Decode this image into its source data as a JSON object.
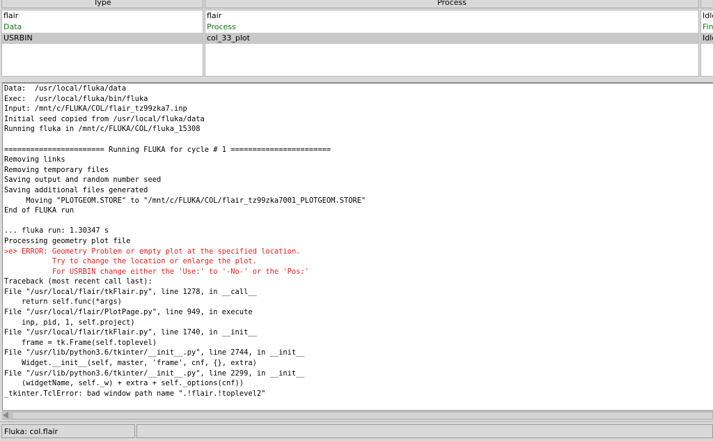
{
  "table": {
    "columns": {
      "type": "Type",
      "process": "Process"
    },
    "rows": [
      {
        "type": "flair",
        "process": "flair",
        "status": "Idle",
        "green": false,
        "selected": false
      },
      {
        "type": "Data",
        "process": "Process",
        "status": "Fin",
        "green": true,
        "selected": false
      },
      {
        "type": "USRBIN",
        "process": "col_33_plot",
        "status": "Idle",
        "green": false,
        "selected": true
      }
    ]
  },
  "log": {
    "lines": [
      {
        "text": "Data:  /usr/local/fluka/data",
        "error": false
      },
      {
        "text": "Exec:  /usr/local/fluka/bin/fluka",
        "error": false
      },
      {
        "text": "Input: /mnt/c/FLUKA/COL/flair_tz99zka7.inp",
        "error": false
      },
      {
        "text": "Initial seed copied from /usr/local/fluka/data",
        "error": false
      },
      {
        "text": "Running fluka in /mnt/c/FLUKA/COL/fluka_15308",
        "error": false
      },
      {
        "text": "",
        "error": false
      },
      {
        "text": "======================= Running FLUKA for cycle # 1 =======================",
        "error": false
      },
      {
        "text": "Removing links",
        "error": false
      },
      {
        "text": "Removing temporary files",
        "error": false
      },
      {
        "text": "Saving output and random number seed",
        "error": false
      },
      {
        "text": "Saving additional files generated",
        "error": false
      },
      {
        "text": "     Moving \"PLOTGEOM.STORE\" to \"/mnt/c/FLUKA/COL/flair_tz99zka7001_PLOTGEOM.STORE\"",
        "error": false
      },
      {
        "text": "End of FLUKA run",
        "error": false
      },
      {
        "text": "",
        "error": false
      },
      {
        "text": "... fluka run: 1.30347 s",
        "error": false
      },
      {
        "text": "Processing geometry plot file",
        "error": false
      },
      {
        "text": ">e> ERROR: Geometry Problem or empty plot at the specified location.",
        "error": true
      },
      {
        "text": "           Try to change the location or enlarge the plot.",
        "error": true
      },
      {
        "text": "           For USRBIN change either the 'Use:' to '-No-' or the 'Pos:'",
        "error": true
      },
      {
        "text": "Traceback (most recent call last):",
        "error": false
      },
      {
        "text": "File \"/usr/local/flair/tkFlair.py\", line 1278, in __call__",
        "error": false
      },
      {
        "text": "    return self.func(*args)",
        "error": false
      },
      {
        "text": "File \"/usr/local/flair/PlotPage.py\", line 949, in execute",
        "error": false
      },
      {
        "text": "    inp, pid, 1, self.project)",
        "error": false
      },
      {
        "text": "File \"/usr/local/flair/tkFlair.py\", line 1740, in __init__",
        "error": false
      },
      {
        "text": "    frame = tk.Frame(self.toplevel)",
        "error": false
      },
      {
        "text": "File \"/usr/lib/python3.6/tkinter/__init__.py\", line 2744, in __init__",
        "error": false
      },
      {
        "text": "    Widget.__init__(self, master, 'frame', cnf, {}, extra)",
        "error": false
      },
      {
        "text": "File \"/usr/lib/python3.6/tkinter/__init__.py\", line 2299, in __init__",
        "error": false
      },
      {
        "text": "    (widgetName, self._w) + extra + self._options(cnf))",
        "error": false
      },
      {
        "text": "_tkinter.TclError: bad window path name \".!flair.!toplevel2\"",
        "error": false
      }
    ]
  },
  "status": {
    "text": "Fluka: col.flair"
  },
  "colors": {
    "error": "#ee1c1c",
    "green": "#0d7a0d",
    "selected": "#c9c9c9"
  },
  "icons": {
    "scroll_left": "arrow-left-icon"
  }
}
